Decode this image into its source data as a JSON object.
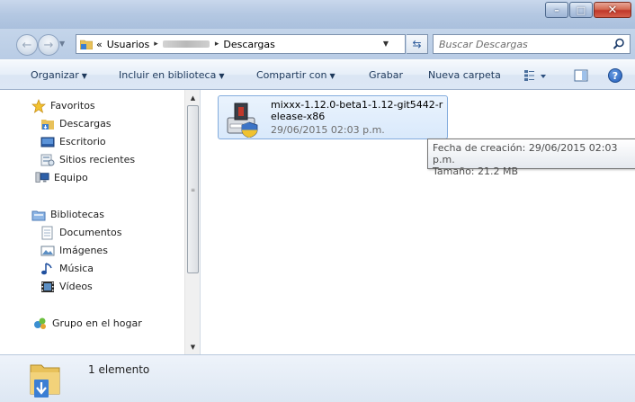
{
  "window": {
    "caption_buttons": {
      "minimize": "–",
      "maximize": "□",
      "close": "✕"
    }
  },
  "address": {
    "crumbs": [
      "«",
      "Usuarios",
      "Descargas"
    ],
    "separator": "▸",
    "search_placeholder": "Buscar Descargas"
  },
  "toolbar": {
    "organize": "Organizar",
    "include_library": "Incluir en biblioteca",
    "share_with": "Compartir con",
    "burn": "Grabar",
    "new_folder": "Nueva carpeta",
    "help": "?"
  },
  "nav": {
    "favorites_header": "Favoritos",
    "favorites": [
      "Descargas",
      "Escritorio",
      "Sitios recientes",
      "Equipo"
    ],
    "libraries_header": "Bibliotecas",
    "libraries": [
      "Documentos",
      "Imágenes",
      "Música",
      "Vídeos"
    ],
    "homegroup": "Grupo en el hogar"
  },
  "file": {
    "name": "mixxx-1.12.0-beta1-1.12-git5442-release-x86",
    "date": "29/06/2015 02:03 p.m."
  },
  "tooltip": {
    "created": "Fecha de creación: 29/06/2015 02:03 p.m.",
    "size": "Tamaño: 21.2 MB"
  },
  "details": {
    "count": "1 elemento"
  }
}
